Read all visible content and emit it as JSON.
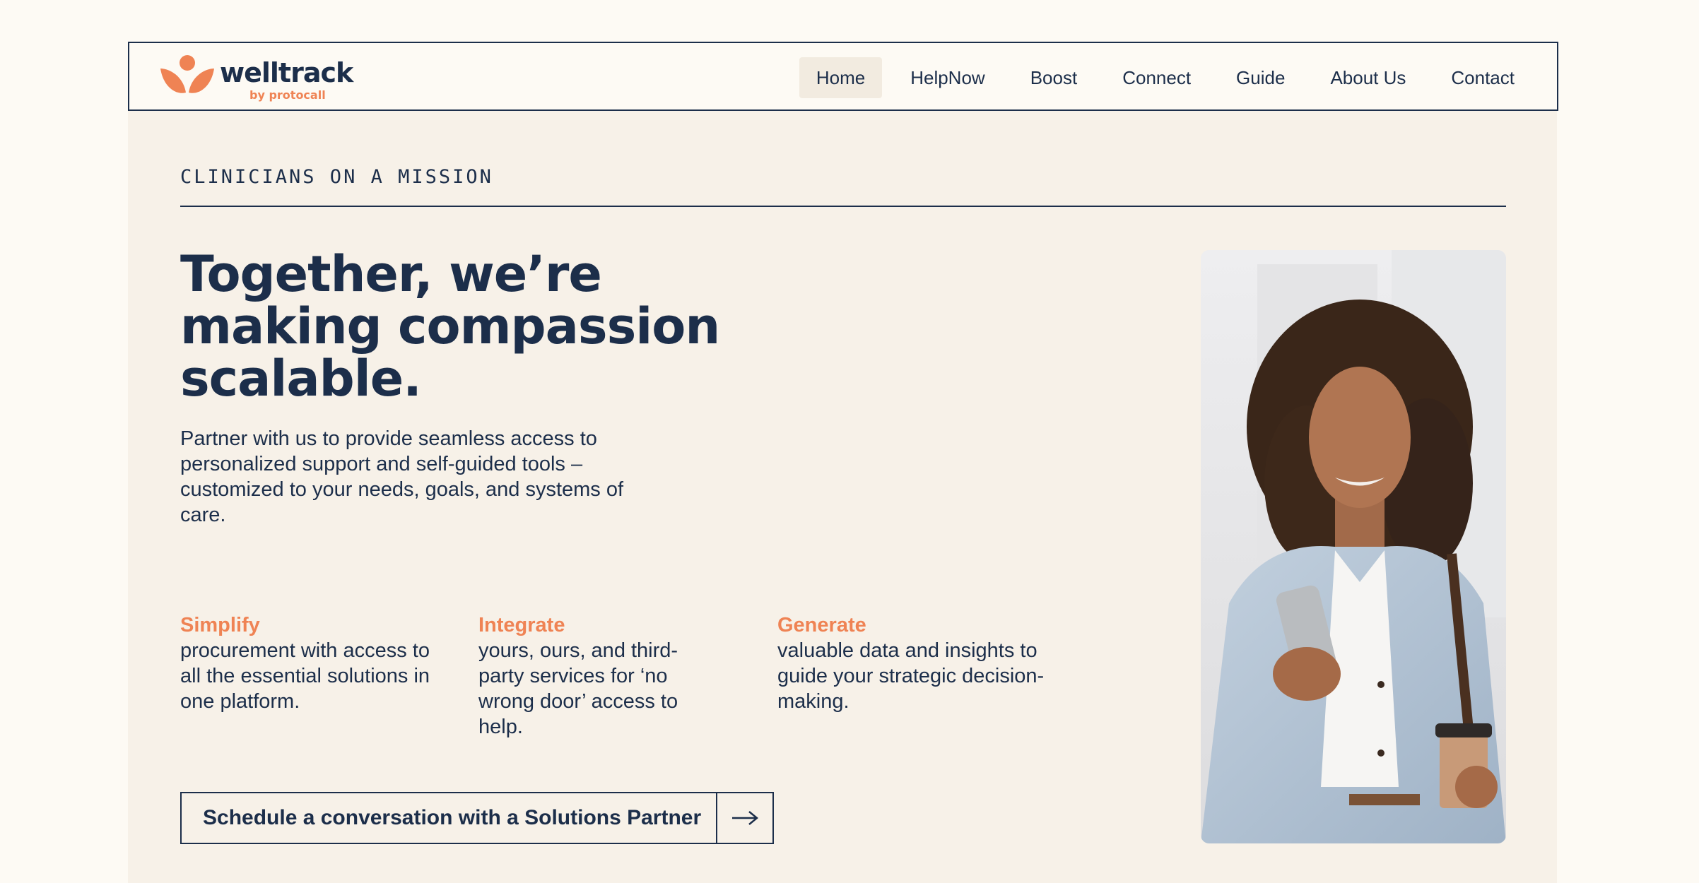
{
  "brand": {
    "name": "welltrack",
    "sub": "by protocall",
    "accent_color": "#ef8354",
    "navy_color": "#1c2e4a"
  },
  "nav": {
    "items": [
      {
        "label": "Home",
        "active": true
      },
      {
        "label": "HelpNow"
      },
      {
        "label": "Boost"
      },
      {
        "label": "Connect"
      },
      {
        "label": "Guide"
      },
      {
        "label": "About Us"
      },
      {
        "label": "Contact"
      }
    ]
  },
  "hero": {
    "eyebrow": "CLINICIANS ON A MISSION",
    "headline": "Together, we’re making compassion scalable.",
    "intro": "Partner with us to provide seamless access to personalized support and self-guided tools – customized to your needs, goals, and systems of care.",
    "features": [
      {
        "title": "Simplify",
        "body": "procurement with access to all the essential solutions in one platform."
      },
      {
        "title": "Integrate",
        "body": "yours, ours, and third-party services for ‘no wrong door’ access to help."
      },
      {
        "title": "Generate",
        "body": "valuable data and insights to guide your strategic decision-making."
      }
    ],
    "cta_label": "Schedule a conversation with a Solutions Partner",
    "cta_icon": "arrow-right-icon",
    "photo_icon": "woman-with-phone-photo"
  }
}
